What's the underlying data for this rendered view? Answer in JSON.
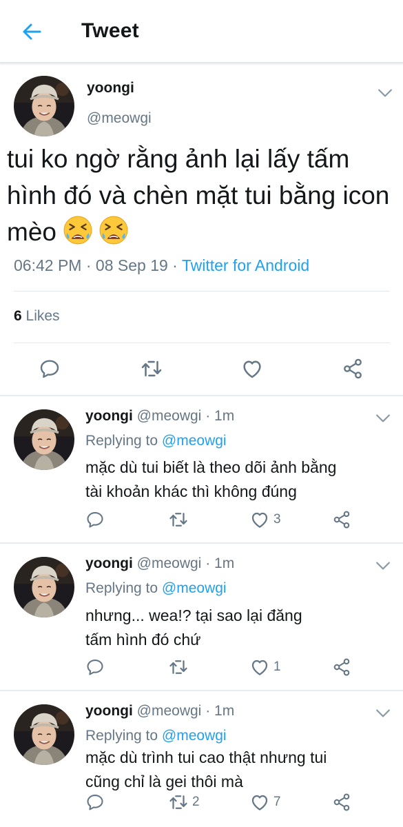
{
  "header": {
    "title": "Tweet",
    "back_icon": "arrow-left-icon"
  },
  "colors": {
    "accent": "#1da1f2",
    "text": "#14171a",
    "muted": "#657786",
    "divider": "#e1e8ed"
  },
  "main_tweet": {
    "name": "yoongi",
    "handle": "@meowgi",
    "text": "tui ko ngờ rằng ảnh lại lấy tấm hình đó và chèn mặt tui bằng icon mèo",
    "emojis": [
      "tired-face-emoji",
      "tired-face-emoji"
    ],
    "time": "06:42 PM",
    "date": "08 Sep 19",
    "source": "Twitter for Android",
    "likes_count": "6",
    "likes_label": "Likes",
    "actions": [
      "reply-icon",
      "retweet-icon",
      "like-icon",
      "share-icon"
    ]
  },
  "replies": [
    {
      "name": "yoongi",
      "handle": "@meowgi",
      "time": "1m",
      "replying_to_label": "Replying to",
      "replying_to": "@meowgi",
      "text_lines": [
        "mặc dù tui biết là theo dõi ảnh bằng",
        "tài khoản khác thì không đúng"
      ],
      "retweets": "",
      "likes": "3"
    },
    {
      "name": "yoongi",
      "handle": "@meowgi",
      "time": "1m",
      "replying_to_label": "Replying to",
      "replying_to": "@meowgi",
      "text_lines": [
        "nhưng... wea!? tại sao lại đăng",
        "tấm hình đó chứ"
      ],
      "retweets": "",
      "likes": "1"
    },
    {
      "name": "yoongi",
      "handle": "@meowgi",
      "time": "1m",
      "replying_to_label": "Replying to",
      "replying_to": "@meowgi",
      "text_lines": [
        "mặc dù trình tui cao thật nhưng tui",
        "cũng chỉ là gei thôi mà"
      ],
      "retweets": "2",
      "likes": "7"
    }
  ]
}
